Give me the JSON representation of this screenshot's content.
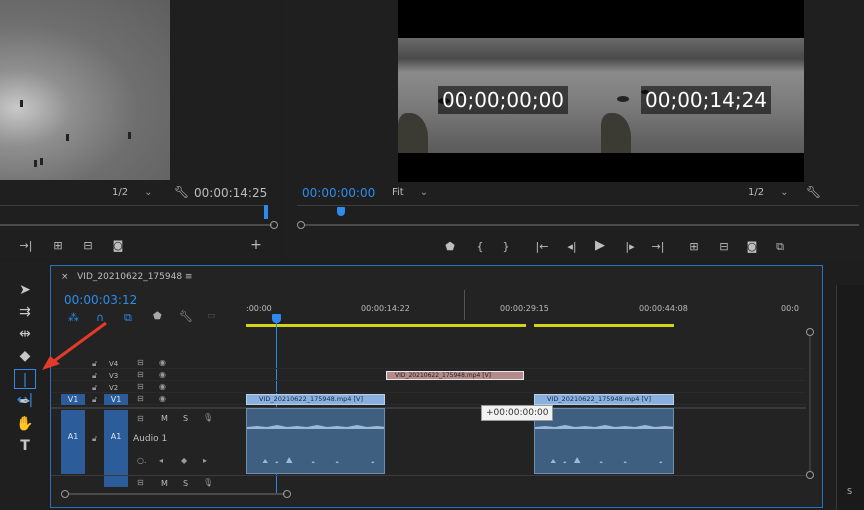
{
  "source_monitor": {
    "zoom": "1/2",
    "timecode": "00:00:14:25"
  },
  "program_monitor": {
    "timecode": "00:00:00:00",
    "fit": "Fit",
    "zoom": "1/2",
    "overlay_left": "00;00;00;00",
    "overlay_right": "00;00;14;24"
  },
  "timeline": {
    "tab_close": "×",
    "tab_title": "VID_20210622_175948",
    "tab_menu": "≡",
    "playhead_time": "00:00:03:12",
    "ruler_labels": [
      ":00:00",
      "00:00:14:22",
      "00:00:29:15",
      "00:00:44:08",
      "00:0"
    ],
    "tracks": {
      "v4": "V4",
      "v3": "V3",
      "v2": "V2",
      "v1": "V1",
      "a1": "A1",
      "audio1": "Audio 1",
      "mute": "M",
      "solo": "S"
    },
    "clips": {
      "v3_clip": "VID_20210622_175948.mp4 [V]",
      "v1_clip_a": "VID_20210622_175948.mp4 [V]",
      "v1_clip_b": "VID_20210622_175948.mp4 [V]"
    },
    "drag_tooltip": "+00:00:00:00"
  },
  "tools": [
    "selection-tool",
    "track-select-tool",
    "ripple-edit-tool",
    "razor-tool",
    "slip-tool",
    "pen-tool",
    "hand-tool",
    "type-tool"
  ],
  "right_panel_label": "S",
  "accent": "#2d8ceb",
  "arrow_color": "#e23b2a"
}
